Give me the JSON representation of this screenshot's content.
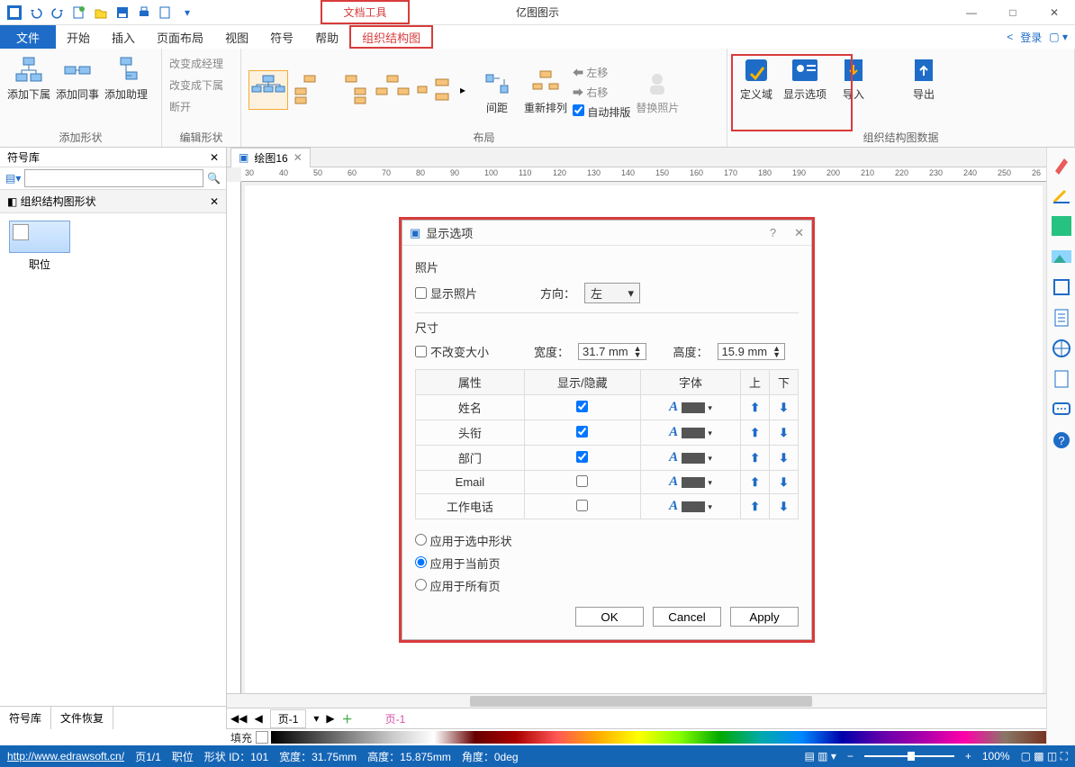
{
  "app": {
    "doctools": "文档工具",
    "product": "亿图图示"
  },
  "window": {
    "min": "—",
    "max": "□",
    "close": "✕"
  },
  "menu": {
    "file": "文件",
    "tabs": [
      "开始",
      "插入",
      "页面布局",
      "视图",
      "符号",
      "帮助",
      "组织结构图"
    ],
    "active_index": 6,
    "login": "登录"
  },
  "ribbon": {
    "groups": {
      "add_shape": {
        "label": "添加形状",
        "btns": [
          "添加下属",
          "添加同事",
          "添加助理"
        ]
      },
      "edit_shape": {
        "label": "编辑形状",
        "items": [
          "改变成经理",
          "改变成下属",
          "断开"
        ]
      },
      "layout": {
        "label": "布局",
        "spacing": "间距",
        "rearr": "重新排列",
        "left": "左移",
        "right": "右移",
        "autolay": "自动排版",
        "replace": "替换照片"
      },
      "data": {
        "label": "组织结构图数据",
        "define": "定义域",
        "display": "显示选项",
        "import": "导入",
        "export": "导出"
      }
    }
  },
  "left": {
    "title": "符号库",
    "category": "组织结构图形状",
    "shape": "职位",
    "btabs": [
      "符号库",
      "文件恢复"
    ]
  },
  "doc": {
    "tab": "绘图16"
  },
  "ruler_marks": [
    30,
    40,
    50,
    60,
    70,
    80,
    90,
    100,
    110,
    120,
    130,
    140,
    150,
    160,
    170,
    180,
    190,
    200,
    210,
    220,
    230,
    240,
    250,
    "26"
  ],
  "dialog": {
    "title": "显示选项",
    "sec_photo": "照片",
    "show_photo": "显示照片",
    "dir_label": "方向：",
    "dir_value": "左",
    "sec_size": "尺寸",
    "keep_size": "不改变大小",
    "w_label": "宽度：",
    "w_val": "31.7 mm",
    "h_label": "高度：",
    "h_val": "15.9 mm",
    "cols": [
      "属性",
      "显示/隐藏",
      "字体",
      "上",
      "下"
    ],
    "rows": [
      {
        "name": "姓名",
        "chk": true
      },
      {
        "name": "头衔",
        "chk": true
      },
      {
        "name": "部门",
        "chk": true
      },
      {
        "name": "Email",
        "chk": false
      },
      {
        "name": "工作电话",
        "chk": false
      }
    ],
    "radios": [
      "应用于选中形状",
      "应用于当前页",
      "应用于所有页"
    ],
    "radio_sel": 1,
    "btns": {
      "ok": "OK",
      "cancel": "Cancel",
      "apply": "Apply"
    }
  },
  "pagetabs": {
    "p1": "页-1",
    "p1b": "页-1"
  },
  "fill_label": "填充",
  "status": {
    "url": "http://www.edrawsoft.cn/",
    "page": "页1/1",
    "pos": "职位",
    "shapeid": "形状 ID：101",
    "w": "宽度：31.75mm",
    "h": "高度：15.875mm",
    "ang": "角度：0deg",
    "zoom": "100%"
  }
}
